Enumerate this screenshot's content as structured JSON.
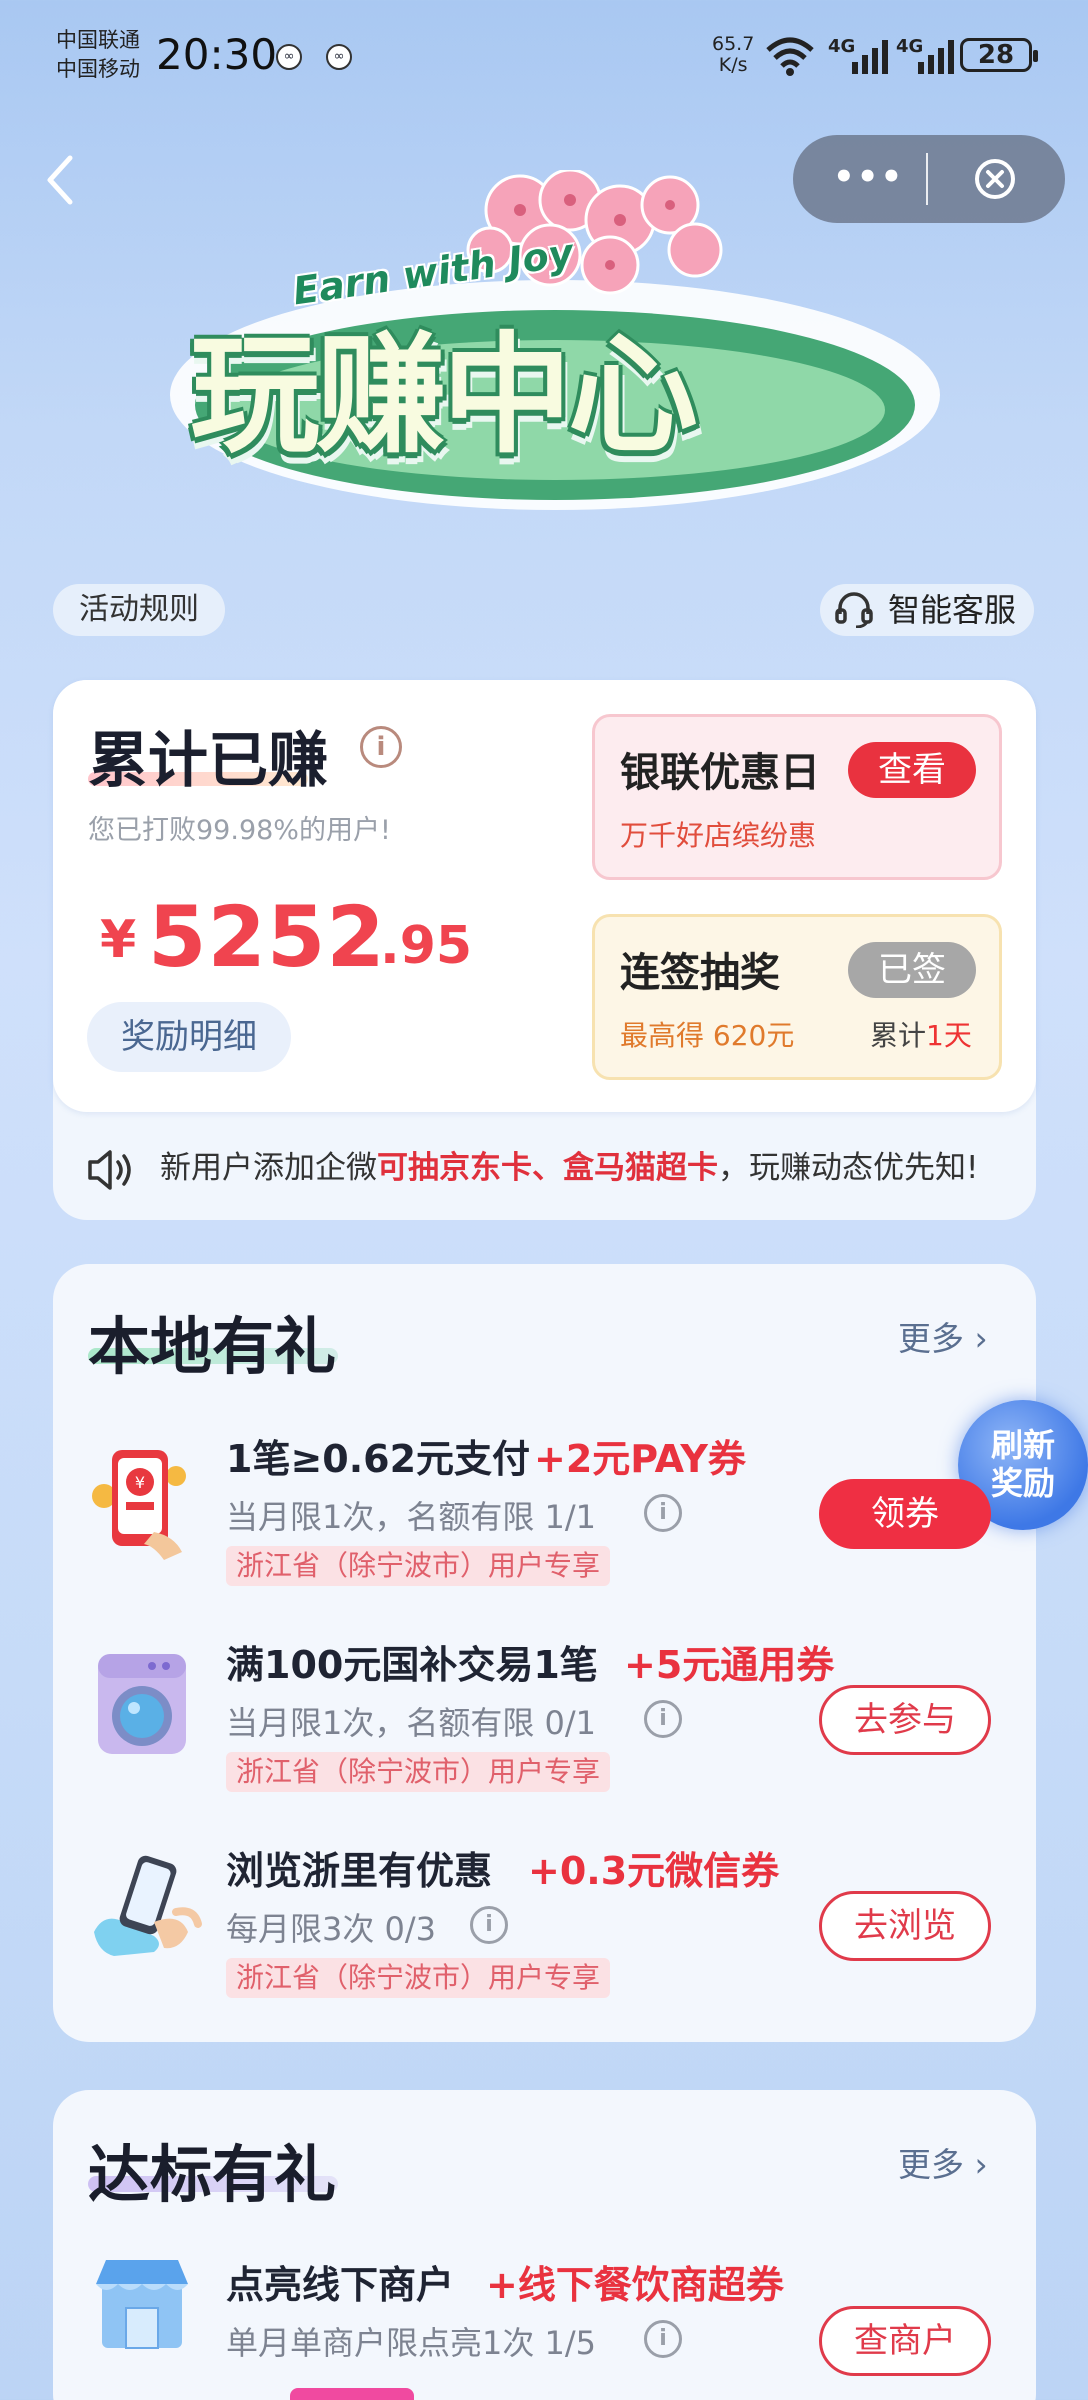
{
  "status_bar": {
    "carrier1": "中国联通",
    "carrier2": "中国移动",
    "time": "20:30",
    "net_speed_value": "65.7",
    "net_speed_unit": "K/s",
    "signal1": "4G",
    "signal2": "4G",
    "battery": "28"
  },
  "header": {
    "banner_subtitle": "Earn with Joy",
    "banner_title": "玩赚中心"
  },
  "top_links": {
    "rules": "活动规则",
    "service": "智能客服"
  },
  "earnings": {
    "title": "累计已赚",
    "subtitle": "您已打败99.98%的用户!",
    "currency": "¥",
    "amount_int": "5252",
    "amount_dec": ".95",
    "detail_button": "奖励明细"
  },
  "unionpay": {
    "title": "银联优惠日",
    "button": "查看",
    "subtitle": "万千好店缤纷惠"
  },
  "signin": {
    "title": "连签抽奖",
    "button": "已签",
    "max_label": "最高得 620元",
    "total_prefix": "累计",
    "total_days": "1天"
  },
  "notice": {
    "prefix": "新用户添加企微",
    "highlight": "可抽京东卡、盒马猫超卡",
    "suffix": "，玩赚动态优先知!"
  },
  "local_gifts": {
    "title": "本地有礼",
    "more": "更多",
    "refresh": [
      "刷新",
      "奖励"
    ],
    "tasks": [
      {
        "title": "1笔≥0.62元支付",
        "reward": "+2元PAY券",
        "limit": "当月限1次，名额有限 1/1",
        "region": "浙江省（除宁波市）用户专享",
        "button": "领券"
      },
      {
        "title": "满100元国补交易1笔",
        "reward": "+5元通用券",
        "limit": "当月限1次，名额有限 0/1",
        "region": "浙江省（除宁波市）用户专享",
        "button": "去参与"
      },
      {
        "title": "浏览浙里有优惠",
        "reward": "+0.3元微信券",
        "limit": "每月限3次 0/3",
        "region": "浙江省（除宁波市）用户专享",
        "button": "去浏览"
      }
    ]
  },
  "standard_gifts": {
    "title": "达标有礼",
    "more": "更多",
    "tasks": [
      {
        "title": "点亮线下商户",
        "reward": "+线下餐饮商超券",
        "limit": "单月单商户限点亮1次 1/5",
        "button": "查商户"
      }
    ]
  },
  "colors": {
    "accent_red": "#ef2f43",
    "reward_red": "#e9323f",
    "banner_green": "#2f8c5d",
    "bg_blue": "#c6dbf8"
  }
}
